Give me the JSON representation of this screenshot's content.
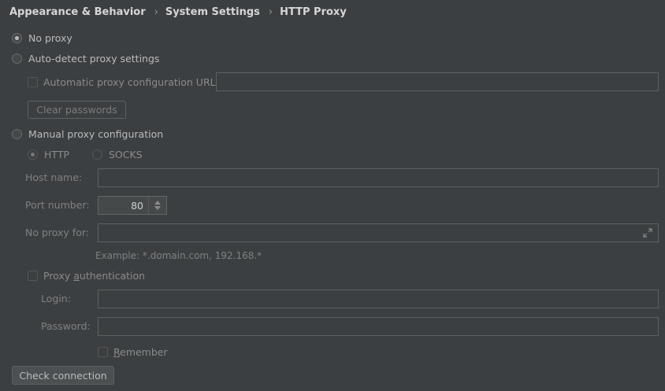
{
  "breadcrumb": {
    "items": [
      "Appearance & Behavior",
      "System Settings",
      "HTTP Proxy"
    ]
  },
  "proxy": {
    "no_proxy_label": "No proxy",
    "auto_detect_label": "Auto-detect proxy settings",
    "auto_config_url_label": "Automatic proxy configuration URL:",
    "auto_config_url_value": "",
    "clear_passwords_label": "Clear passwords",
    "manual_label": "Manual proxy configuration",
    "http_label": "HTTP",
    "socks_label": "SOCKS",
    "host_label": "Host name:",
    "host_value": "",
    "port_label": "Port number:",
    "port_value": "80",
    "no_proxy_for_label": "No proxy for:",
    "no_proxy_for_value": "",
    "example_text": "Example: *.domain.com, 192.168.*",
    "auth_label_pre": "Proxy ",
    "auth_label_mnemonic": "a",
    "auth_label_post": "uthentication",
    "login_label": "Login:",
    "login_value": "",
    "password_label": "Password:",
    "password_value": "",
    "remember_mnemonic": "R",
    "remember_post": "emember",
    "check_connection_label": "Check connection"
  },
  "state": {
    "selected_mode": "No proxy",
    "manual_type": "HTTP"
  },
  "colors": {
    "background": "#3c3f41",
    "text": "#bbbbbb",
    "disabled_text": "#808080",
    "border": "#5e6060"
  },
  "icons": {
    "expand": "expand-icon",
    "breadcrumb_separator": "chevron-right-icon"
  }
}
